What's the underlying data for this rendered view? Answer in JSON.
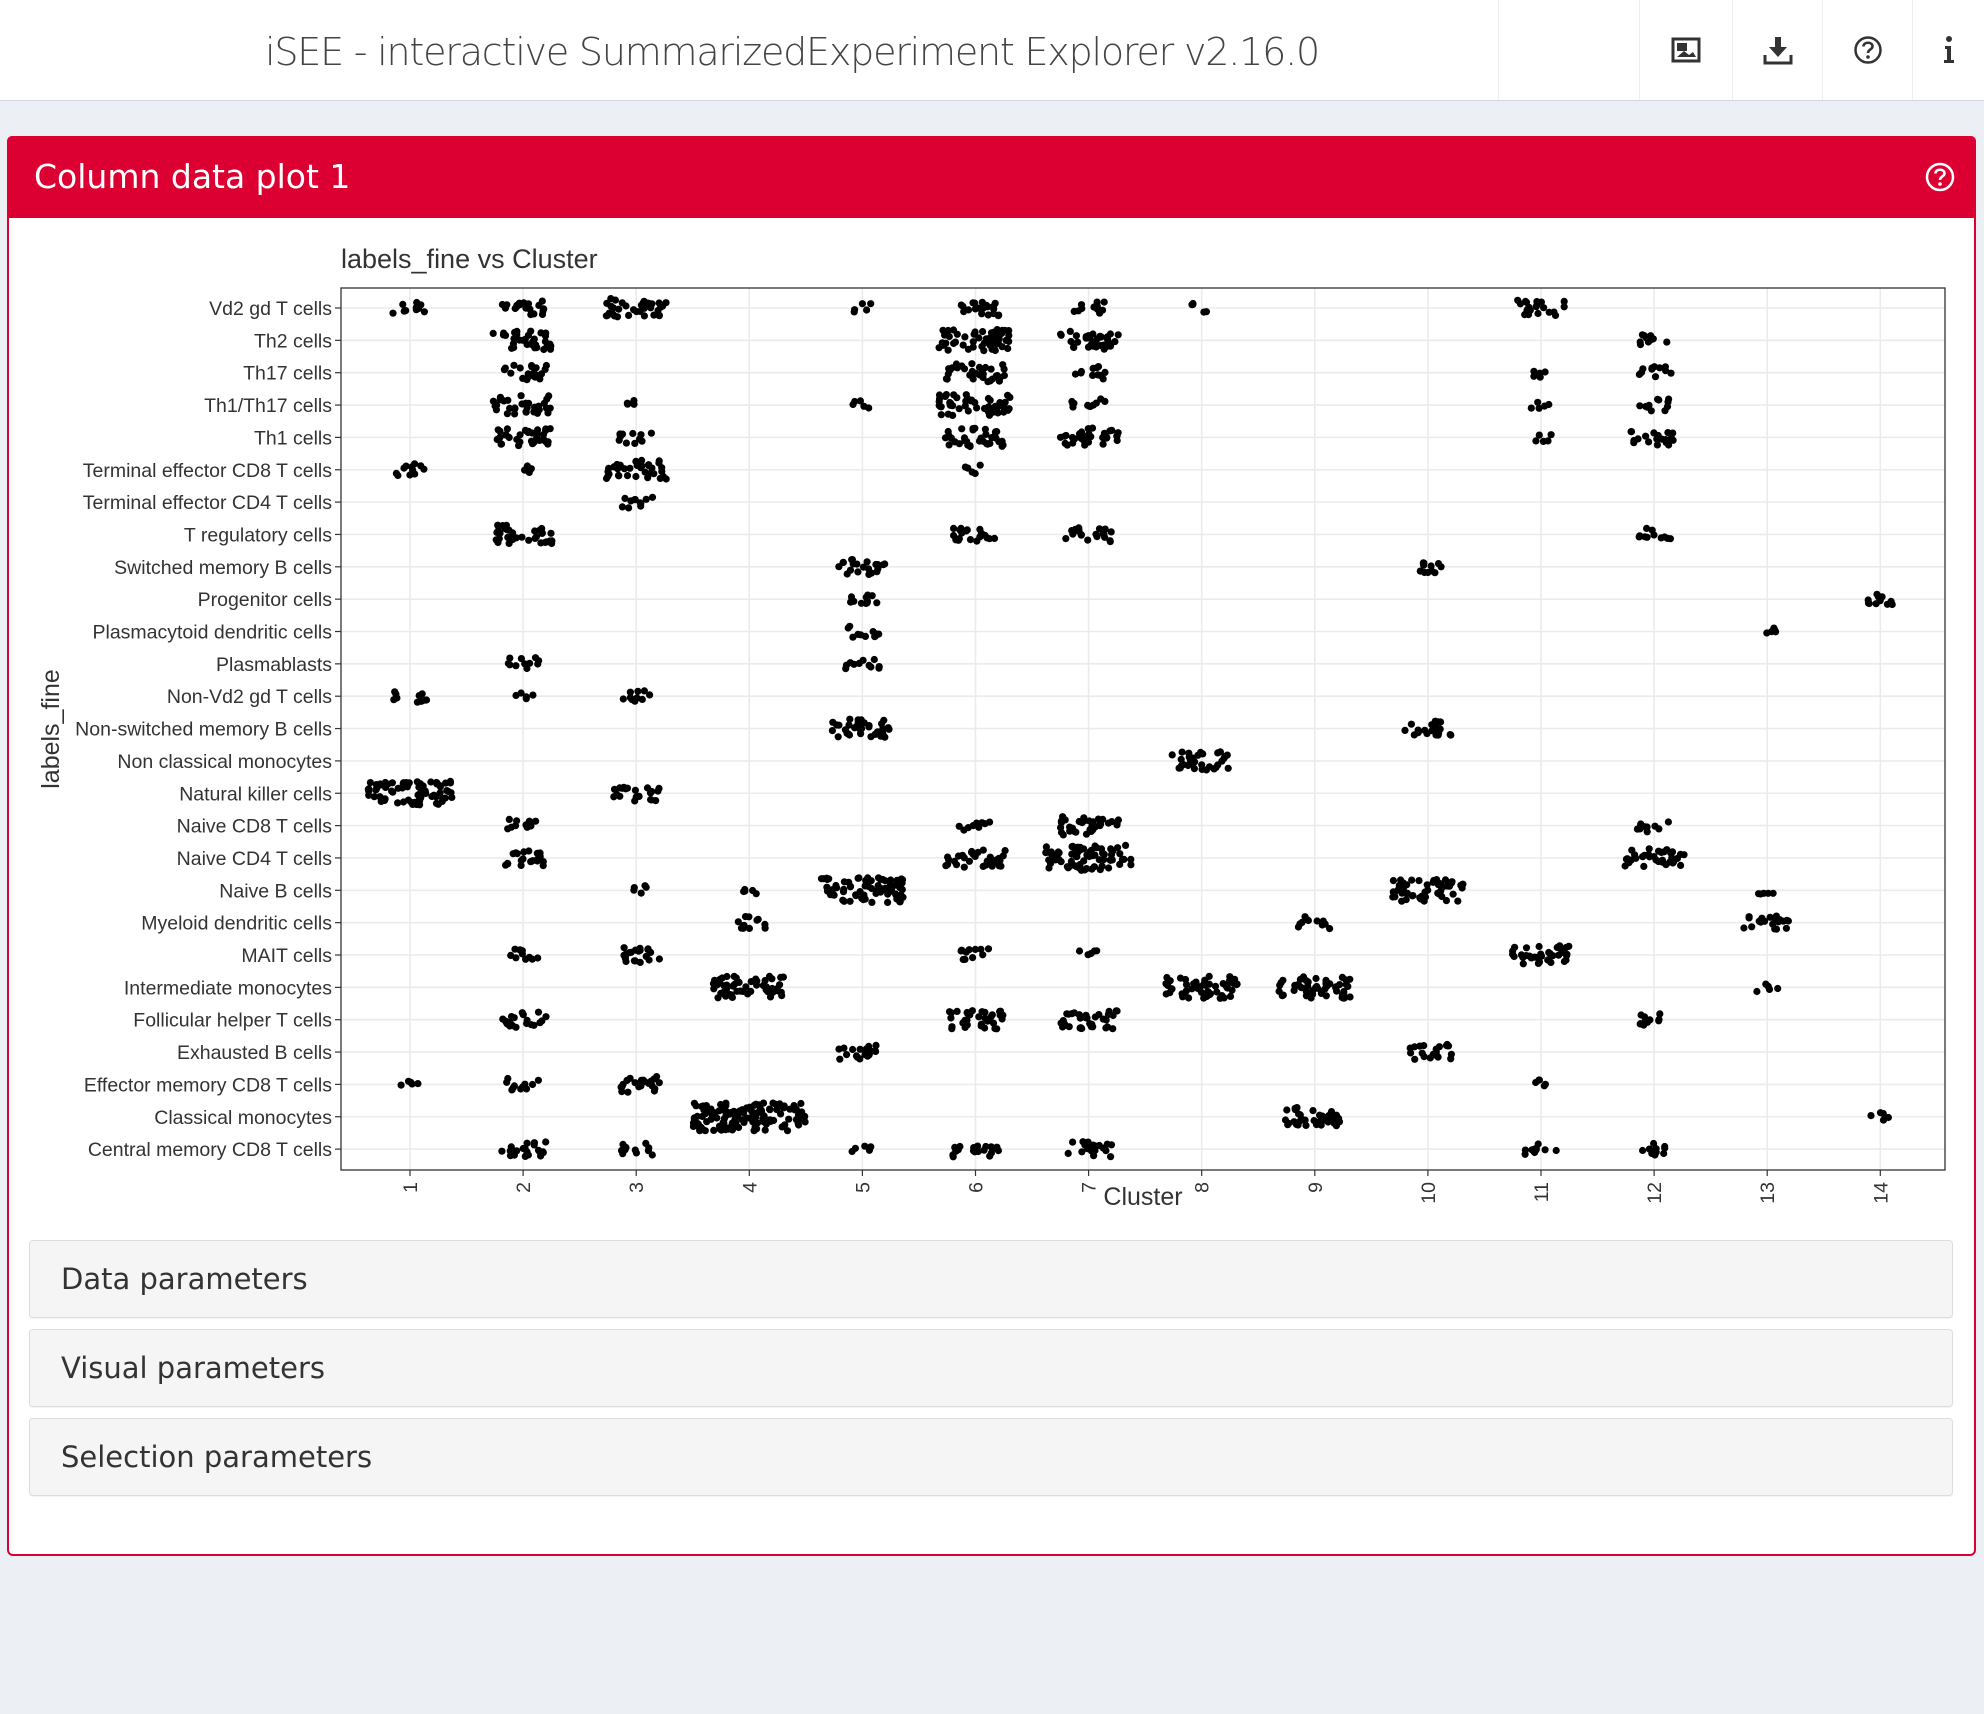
{
  "header": {
    "title": "iSEE - interactive SummarizedExperiment Explorer v2.16.0",
    "buttons": [
      {
        "icon": "image-icon",
        "label": "Export panel image"
      },
      {
        "icon": "download-icon",
        "label": "Download"
      },
      {
        "icon": "question-circle-icon",
        "label": "Help"
      },
      {
        "icon": "info-icon",
        "label": "Session info"
      }
    ]
  },
  "panel": {
    "title": "Column data plot 1",
    "help_icon": "question-circle-icon",
    "accent_color": "#dc0032",
    "sections": [
      {
        "label": "Data parameters"
      },
      {
        "label": "Visual parameters"
      },
      {
        "label": "Selection parameters"
      }
    ]
  },
  "chart_data": {
    "type": "scatter",
    "title": "labels_fine vs Cluster",
    "xlabel": "Cluster",
    "ylabel": "labels_fine",
    "grid": true,
    "x_categories": [
      "1",
      "2",
      "3",
      "4",
      "5",
      "6",
      "7",
      "8",
      "9",
      "10",
      "11",
      "12",
      "13",
      "14"
    ],
    "y_categories": [
      "Vd2 gd T cells",
      "Th2 cells",
      "Th17 cells",
      "Th1/Th17 cells",
      "Th1 cells",
      "Terminal effector CD8 T cells",
      "Terminal effector CD4 T cells",
      "T regulatory cells",
      "Switched memory B cells",
      "Progenitor cells",
      "Plasmacytoid dendritic cells",
      "Plasmablasts",
      "Non-Vd2 gd T cells",
      "Non-switched memory B cells",
      "Non classical monocytes",
      "Natural killer cells",
      "Naive CD8 T cells",
      "Naive CD4 T cells",
      "Naive B cells",
      "Myeloid dendritic cells",
      "MAIT cells",
      "Intermediate monocytes",
      "Follicular helper T cells",
      "Exhausted B cells",
      "Effector memory CD8 T cells",
      "Classical monocytes",
      "Central memory CD8 T cells"
    ],
    "clusters": [
      {
        "y": "Vd2 gd T cells",
        "x": 1,
        "size": 2
      },
      {
        "y": "Vd2 gd T cells",
        "x": 2,
        "size": 3
      },
      {
        "y": "Vd2 gd T cells",
        "x": 3,
        "size": 4
      },
      {
        "y": "Vd2 gd T cells",
        "x": 5,
        "size": 1
      },
      {
        "y": "Vd2 gd T cells",
        "x": 6,
        "size": 3
      },
      {
        "y": "Vd2 gd T cells",
        "x": 7,
        "size": 2
      },
      {
        "y": "Vd2 gd T cells",
        "x": 8,
        "size": 1
      },
      {
        "y": "Vd2 gd T cells",
        "x": 11,
        "size": 3
      },
      {
        "y": "Th2 cells",
        "x": 2,
        "size": 4
      },
      {
        "y": "Th2 cells",
        "x": 6,
        "size": 5
      },
      {
        "y": "Th2 cells",
        "x": 7,
        "size": 4
      },
      {
        "y": "Th2 cells",
        "x": 12,
        "size": 2
      },
      {
        "y": "Th17 cells",
        "x": 2,
        "size": 3
      },
      {
        "y": "Th17 cells",
        "x": 6,
        "size": 4
      },
      {
        "y": "Th17 cells",
        "x": 7,
        "size": 2
      },
      {
        "y": "Th17 cells",
        "x": 11,
        "size": 1
      },
      {
        "y": "Th17 cells",
        "x": 12,
        "size": 2
      },
      {
        "y": "Th1/Th17 cells",
        "x": 2,
        "size": 4
      },
      {
        "y": "Th1/Th17 cells",
        "x": 3,
        "size": 1
      },
      {
        "y": "Th1/Th17 cells",
        "x": 5,
        "size": 1
      },
      {
        "y": "Th1/Th17 cells",
        "x": 6,
        "size": 5
      },
      {
        "y": "Th1/Th17 cells",
        "x": 7,
        "size": 2
      },
      {
        "y": "Th1/Th17 cells",
        "x": 11,
        "size": 1
      },
      {
        "y": "Th1/Th17 cells",
        "x": 12,
        "size": 2
      },
      {
        "y": "Th1 cells",
        "x": 2,
        "size": 4
      },
      {
        "y": "Th1 cells",
        "x": 3,
        "size": 2
      },
      {
        "y": "Th1 cells",
        "x": 6,
        "size": 4
      },
      {
        "y": "Th1 cells",
        "x": 7,
        "size": 4
      },
      {
        "y": "Th1 cells",
        "x": 11,
        "size": 1
      },
      {
        "y": "Th1 cells",
        "x": 12,
        "size": 3
      },
      {
        "y": "Terminal effector CD8 T cells",
        "x": 1,
        "size": 2
      },
      {
        "y": "Terminal effector CD8 T cells",
        "x": 2,
        "size": 1
      },
      {
        "y": "Terminal effector CD8 T cells",
        "x": 3,
        "size": 4
      },
      {
        "y": "Terminal effector CD8 T cells",
        "x": 6,
        "size": 1
      },
      {
        "y": "Terminal effector CD4 T cells",
        "x": 3,
        "size": 2
      },
      {
        "y": "T regulatory cells",
        "x": 2,
        "size": 4
      },
      {
        "y": "T regulatory cells",
        "x": 6,
        "size": 3
      },
      {
        "y": "T regulatory cells",
        "x": 7,
        "size": 3
      },
      {
        "y": "T regulatory cells",
        "x": 12,
        "size": 2
      },
      {
        "y": "Switched memory B cells",
        "x": 5,
        "size": 3
      },
      {
        "y": "Switched memory B cells",
        "x": 10,
        "size": 2
      },
      {
        "y": "Progenitor cells",
        "x": 5,
        "size": 2
      },
      {
        "y": "Progenitor cells",
        "x": 14,
        "size": 2
      },
      {
        "y": "Plasmacytoid dendritic cells",
        "x": 5,
        "size": 2
      },
      {
        "y": "Plasmacytoid dendritic cells",
        "x": 13,
        "size": 1
      },
      {
        "y": "Plasmablasts",
        "x": 2,
        "size": 2
      },
      {
        "y": "Plasmablasts",
        "x": 5,
        "size": 2
      },
      {
        "y": "Non-Vd2 gd T cells",
        "x": 1,
        "size": 2
      },
      {
        "y": "Non-Vd2 gd T cells",
        "x": 2,
        "size": 1
      },
      {
        "y": "Non-Vd2 gd T cells",
        "x": 3,
        "size": 2
      },
      {
        "y": "Non-switched memory B cells",
        "x": 5,
        "size": 4
      },
      {
        "y": "Non-switched memory B cells",
        "x": 10,
        "size": 3
      },
      {
        "y": "Non classical monocytes",
        "x": 8,
        "size": 4
      },
      {
        "y": "Natural killer cells",
        "x": 1,
        "size": 6
      },
      {
        "y": "Natural killer cells",
        "x": 3,
        "size": 3
      },
      {
        "y": "Naive CD8 T cells",
        "x": 2,
        "size": 2
      },
      {
        "y": "Naive CD8 T cells",
        "x": 6,
        "size": 2
      },
      {
        "y": "Naive CD8 T cells",
        "x": 7,
        "size": 4
      },
      {
        "y": "Naive CD8 T cells",
        "x": 12,
        "size": 2
      },
      {
        "y": "Naive CD4 T cells",
        "x": 2,
        "size": 3
      },
      {
        "y": "Naive CD4 T cells",
        "x": 6,
        "size": 4
      },
      {
        "y": "Naive CD4 T cells",
        "x": 7,
        "size": 6
      },
      {
        "y": "Naive CD4 T cells",
        "x": 12,
        "size": 4
      },
      {
        "y": "Naive B cells",
        "x": 3,
        "size": 1
      },
      {
        "y": "Naive B cells",
        "x": 4,
        "size": 1
      },
      {
        "y": "Naive B cells",
        "x": 5,
        "size": 6
      },
      {
        "y": "Naive B cells",
        "x": 10,
        "size": 5
      },
      {
        "y": "Naive B cells",
        "x": 13,
        "size": 1
      },
      {
        "y": "Myeloid dendritic cells",
        "x": 4,
        "size": 2
      },
      {
        "y": "Myeloid dendritic cells",
        "x": 9,
        "size": 2
      },
      {
        "y": "Myeloid dendritic cells",
        "x": 13,
        "size": 3
      },
      {
        "y": "MAIT cells",
        "x": 2,
        "size": 2
      },
      {
        "y": "MAIT cells",
        "x": 3,
        "size": 3
      },
      {
        "y": "MAIT cells",
        "x": 6,
        "size": 2
      },
      {
        "y": "MAIT cells",
        "x": 7,
        "size": 1
      },
      {
        "y": "MAIT cells",
        "x": 11,
        "size": 4
      },
      {
        "y": "Intermediate monocytes",
        "x": 4,
        "size": 5
      },
      {
        "y": "Intermediate monocytes",
        "x": 8,
        "size": 5
      },
      {
        "y": "Intermediate monocytes",
        "x": 9,
        "size": 5
      },
      {
        "y": "Intermediate monocytes",
        "x": 13,
        "size": 1
      },
      {
        "y": "Follicular helper T cells",
        "x": 2,
        "size": 3
      },
      {
        "y": "Follicular helper T cells",
        "x": 6,
        "size": 4
      },
      {
        "y": "Follicular helper T cells",
        "x": 7,
        "size": 4
      },
      {
        "y": "Follicular helper T cells",
        "x": 12,
        "size": 2
      },
      {
        "y": "Exhausted B cells",
        "x": 5,
        "size": 3
      },
      {
        "y": "Exhausted B cells",
        "x": 10,
        "size": 3
      },
      {
        "y": "Effector memory CD8 T cells",
        "x": 1,
        "size": 1
      },
      {
        "y": "Effector memory CD8 T cells",
        "x": 2,
        "size": 2
      },
      {
        "y": "Effector memory CD8 T cells",
        "x": 3,
        "size": 3
      },
      {
        "y": "Effector memory CD8 T cells",
        "x": 11,
        "size": 1
      },
      {
        "y": "Classical monocytes",
        "x": 4,
        "size": 8
      },
      {
        "y": "Classical monocytes",
        "x": 9,
        "size": 4
      },
      {
        "y": "Classical monocytes",
        "x": 14,
        "size": 1
      },
      {
        "y": "Central memory CD8 T cells",
        "x": 2,
        "size": 3
      },
      {
        "y": "Central memory CD8 T cells",
        "x": 3,
        "size": 2
      },
      {
        "y": "Central memory CD8 T cells",
        "x": 5,
        "size": 1
      },
      {
        "y": "Central memory CD8 T cells",
        "x": 6,
        "size": 3
      },
      {
        "y": "Central memory CD8 T cells",
        "x": 7,
        "size": 3
      },
      {
        "y": "Central memory CD8 T cells",
        "x": 11,
        "size": 2
      },
      {
        "y": "Central memory CD8 T cells",
        "x": 12,
        "size": 2
      }
    ]
  }
}
